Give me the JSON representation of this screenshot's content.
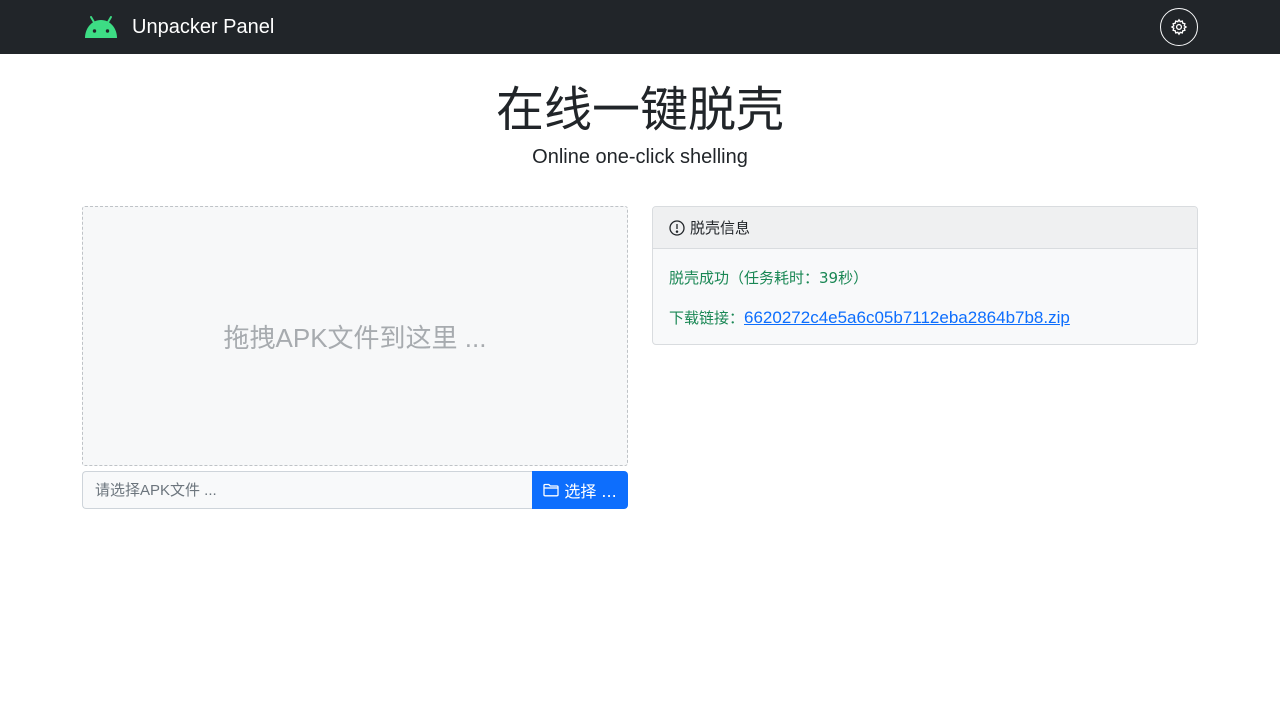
{
  "navbar": {
    "brand": "Unpacker Panel",
    "logo_icon": "android-icon",
    "logo_color": "#3ddc84",
    "settings_icon": "gear-icon"
  },
  "hero": {
    "title": "在线一键脱壳",
    "subtitle": "Online one-click shelling"
  },
  "dropzone": {
    "text": "拖拽APK文件到这里 ..."
  },
  "file_picker": {
    "placeholder": "请选择APK文件 ...",
    "value": "",
    "button_label": "选择 ...",
    "button_icon": "folder-icon"
  },
  "info_card": {
    "icon": "exclamation-circle-icon",
    "title": "脱壳信息",
    "status": "脱壳成功（任务耗时：39秒）",
    "download_prefix": "下载链接：",
    "download_link": "6620272c4e5a6c05b7112eba2864b7b8.zip"
  },
  "colors": {
    "navbar_bg": "#212529",
    "primary": "#0d6efd",
    "success": "#198754"
  }
}
